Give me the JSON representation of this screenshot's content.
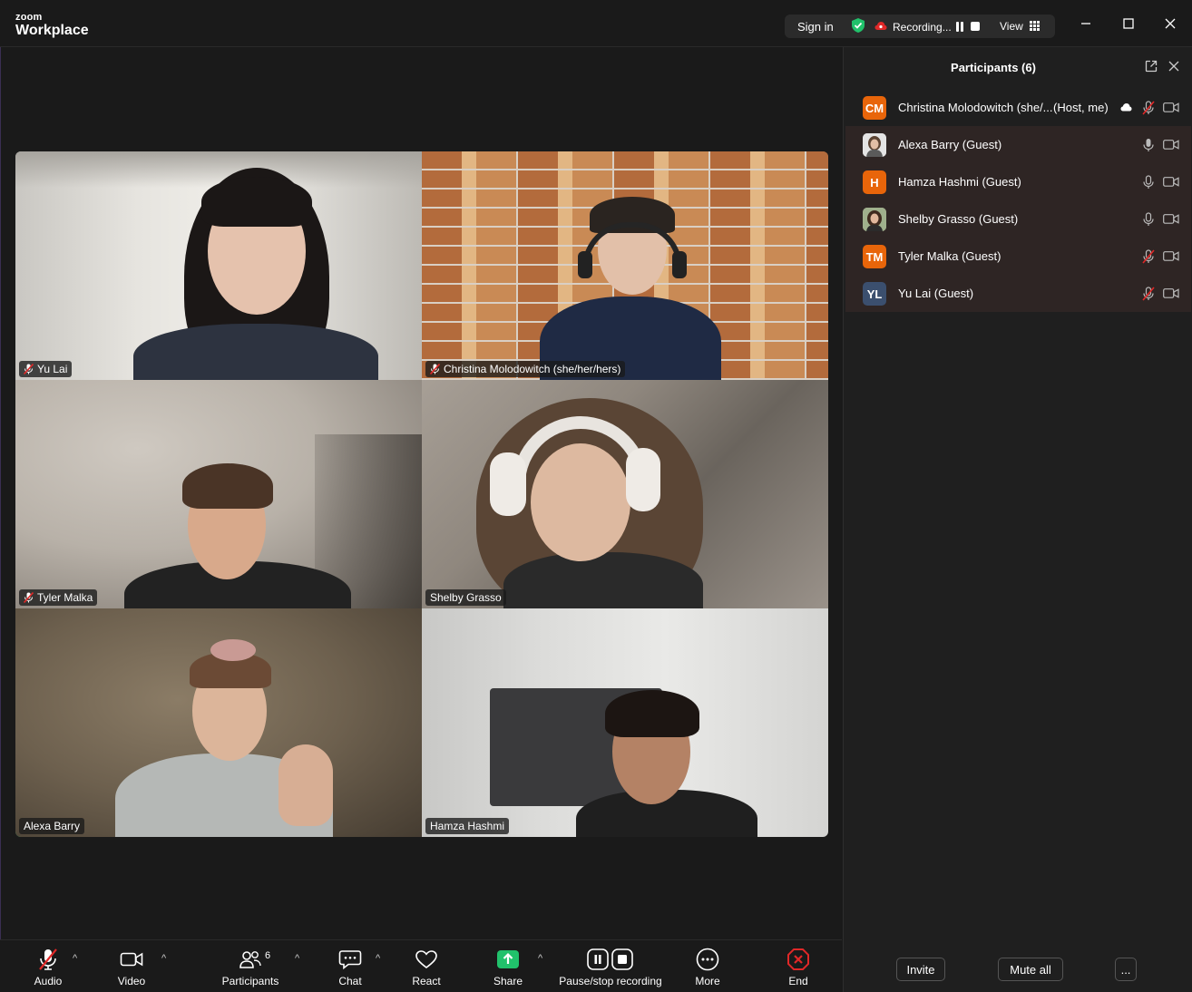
{
  "app": {
    "brand_small": "zoom",
    "brand_big": "Workplace"
  },
  "titlebar": {
    "sign_in": "Sign in",
    "recording_label": "Recording...",
    "view_label": "View"
  },
  "tiles": [
    {
      "name": "Yu Lai",
      "muted": true
    },
    {
      "name": "Christina Molodowitch (she/her/hers)",
      "muted": true
    },
    {
      "name": "Tyler Malka",
      "muted": true
    },
    {
      "name": "Shelby Grasso",
      "muted": false
    },
    {
      "name": "Alexa Barry",
      "muted": false,
      "active_speaker": true
    },
    {
      "name": "Hamza Hashmi",
      "muted": false
    }
  ],
  "toolbar": {
    "audio": "Audio",
    "video": "Video",
    "participants": "Participants",
    "participants_count": "6",
    "chat": "Chat",
    "react": "React",
    "share": "Share",
    "pause_stop": "Pause/stop recording",
    "more": "More",
    "end": "End"
  },
  "panel": {
    "title": "Participants (6)",
    "participants": [
      {
        "initials": "CM",
        "name": "Christina Molodowitch (she/...",
        "suffix": "(Host, me)",
        "avatar_color": "#e8650a",
        "muted": true,
        "recording_cloud": true
      },
      {
        "initials": "",
        "name": "Alexa Barry (Guest)",
        "suffix": "",
        "avatar_color": "#d9d9d9",
        "muted": false,
        "photo": true
      },
      {
        "initials": "H",
        "name": "Hamza Hashmi (Guest)",
        "suffix": "",
        "avatar_color": "#e8650a",
        "muted": false
      },
      {
        "initials": "",
        "name": "Shelby Grasso (Guest)",
        "suffix": "",
        "avatar_color": "#c7b9a5",
        "muted": false,
        "photo": true
      },
      {
        "initials": "TM",
        "name": "Tyler Malka (Guest)",
        "suffix": "",
        "avatar_color": "#e8650a",
        "muted": true
      },
      {
        "initials": "YL",
        "name": "Yu Lai (Guest)",
        "suffix": "",
        "avatar_color": "#3b4f6e",
        "muted": true
      }
    ],
    "invite": "Invite",
    "mute_all": "Mute all",
    "more": "..."
  },
  "colors": {
    "accent_green": "#21c16b",
    "recording_red": "#e02828",
    "end_red": "#e02828",
    "share_green": "#21c16b"
  }
}
